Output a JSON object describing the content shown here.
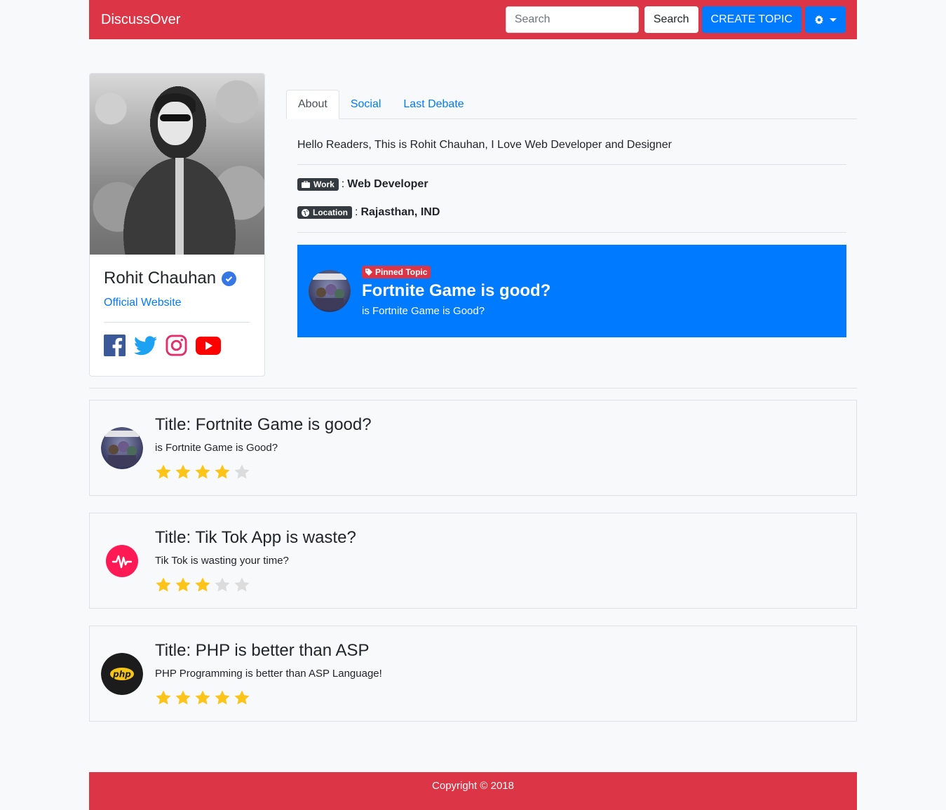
{
  "navbar": {
    "brand": "DiscussOver",
    "search_placeholder": "Search",
    "search_button": "Search",
    "create_button": "CREATE TOPIC",
    "settings_icon": "gear-icon",
    "brand_color": "#dc3545"
  },
  "profile": {
    "name": "Rohit Chauhan",
    "verified_icon": "check-circle-icon",
    "website_label": "Official Website",
    "socials": [
      "facebook-icon",
      "twitter-icon",
      "instagram-icon",
      "youtube-icon"
    ]
  },
  "tabs": [
    {
      "label": "About",
      "active": true
    },
    {
      "label": "Social",
      "active": false
    },
    {
      "label": "Last Debate",
      "active": false
    }
  ],
  "about": {
    "bio": "Hello Readers, This is Rohit Chauhan, I Love Web Developer and Designer",
    "work_label": "Work",
    "work_value": "Web Developer",
    "location_label": "Location",
    "location_value": "Rajasthan, IND",
    "separator": ":"
  },
  "pinned": {
    "badge": "Pinned Topic",
    "title": "Fortnite Game is good?",
    "description": "is Fortnite Game is Good?",
    "color": "#007bff"
  },
  "topics": [
    {
      "title": "Title: Fortnite Game is good?",
      "description": "is Fortnite Game is Good?",
      "rating": 4,
      "thumb": "fortnite-thumbnail"
    },
    {
      "title": "Title: Tik Tok App is waste?",
      "description": "Tik Tok is wasting your time?",
      "rating": 3,
      "thumb": "musically-logo"
    },
    {
      "title": "Title: PHP is better than ASP",
      "description": "PHP Programming is better than ASP Language!",
      "rating": 5,
      "thumb": "php-logo"
    }
  ],
  "footer": {
    "copyright": "Copyright © 2018"
  }
}
